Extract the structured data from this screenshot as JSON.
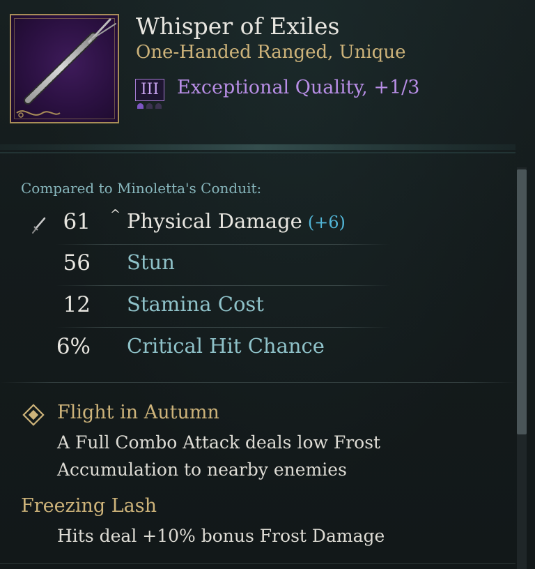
{
  "item": {
    "name": "Whisper of Exiles",
    "type_line": "One-Handed Ranged, Unique",
    "quality_tier": "III",
    "quality_text": "Exceptional Quality, +1/3",
    "quality_pips": {
      "filled": 1,
      "total": 3
    },
    "image_icon": "staff-weapon-icon"
  },
  "comparison": {
    "header": "Compared to Minoletta's Conduit:",
    "stats": [
      {
        "value": "61",
        "label": "Physical Damage",
        "delta": "(+6)",
        "increase_marker": "^",
        "icon": "sword-icon"
      },
      {
        "value": "56",
        "label": "Stun"
      },
      {
        "value": "12",
        "label": "Stamina Cost"
      },
      {
        "value": "6%",
        "label": "Critical Hit Chance"
      }
    ]
  },
  "perks": [
    {
      "icon": "diamond-icon",
      "name": "Flight in Autumn",
      "description": [
        "A Full Combo Attack deals low Frost",
        "Accumulation to nearby enemies"
      ]
    },
    {
      "name": "Freezing Lash",
      "description": [
        "Hits deal +10% bonus Frost Damage"
      ]
    }
  ],
  "colors": {
    "background": "#141a1b",
    "title": "#e8e6e0",
    "gold": "#cdb37a",
    "quality_purple": "#b88ee6",
    "stat_teal": "#8fc2c9",
    "delta_blue": "#52b6d8"
  }
}
